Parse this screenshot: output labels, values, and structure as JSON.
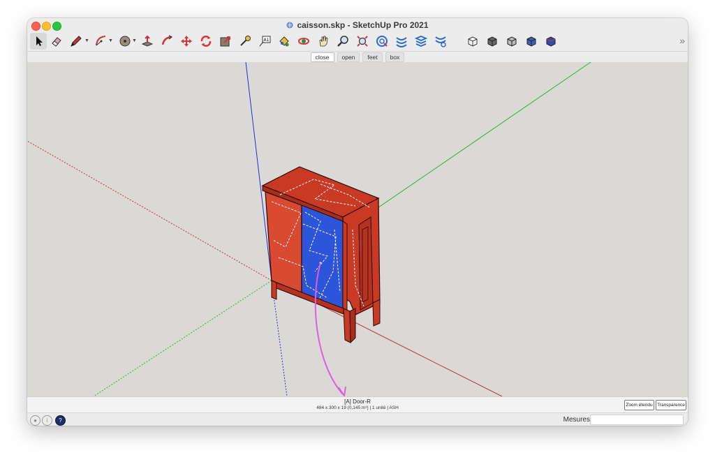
{
  "window": {
    "title": "caisson.skp - SketchUp Pro 2021"
  },
  "toolbar": {
    "tools": [
      {
        "name": "select-icon",
        "active": true
      },
      {
        "name": "eraser-icon"
      },
      {
        "name": "pencil-icon",
        "dropdown": true
      },
      {
        "name": "arc-icon",
        "dropdown": true
      },
      {
        "name": "circle-icon",
        "dropdown": true
      },
      {
        "name": "push-pull-icon"
      },
      {
        "name": "follow-me-icon"
      },
      {
        "name": "move-icon"
      },
      {
        "name": "rotate-icon"
      },
      {
        "name": "scale-icon"
      },
      {
        "name": "tape-measure-icon"
      },
      {
        "name": "text-icon"
      },
      {
        "name": "paint-bucket-icon"
      },
      {
        "name": "orbit-icon"
      },
      {
        "name": "pan-icon"
      },
      {
        "name": "zoom-icon"
      },
      {
        "name": "zoom-extents-icon"
      },
      {
        "name": "extension-1-icon"
      },
      {
        "name": "extension-2-icon"
      },
      {
        "name": "extension-3-icon"
      },
      {
        "name": "extension-4-icon"
      },
      {
        "name": "style-1-icon"
      },
      {
        "name": "style-2-icon"
      },
      {
        "name": "style-3-icon"
      },
      {
        "name": "style-4-icon"
      },
      {
        "name": "style-5-icon"
      }
    ],
    "overflow": "»"
  },
  "scenes": {
    "tabs": [
      "close",
      "open",
      "feet",
      "box"
    ],
    "selected": "close"
  },
  "infobar": {
    "title": "[A] Door-R",
    "details": "484 x 300 x 19 (0,145 m³) | 1 unité | ASH",
    "zoom_button": "Zoom étendu",
    "transparency_button": "Transparence"
  },
  "statusbar": {
    "measurements_label": "Mesures",
    "measurements_value": ""
  },
  "colors": {
    "viewport_bg": "#dad9d6",
    "material_red": "#c93a24",
    "material_blue": "#2c55d9",
    "axis_red": "#c43030",
    "axis_green": "#2cb52c",
    "axis_blue": "#2a2ad0",
    "annotation_magenta": "#e05ce0"
  }
}
